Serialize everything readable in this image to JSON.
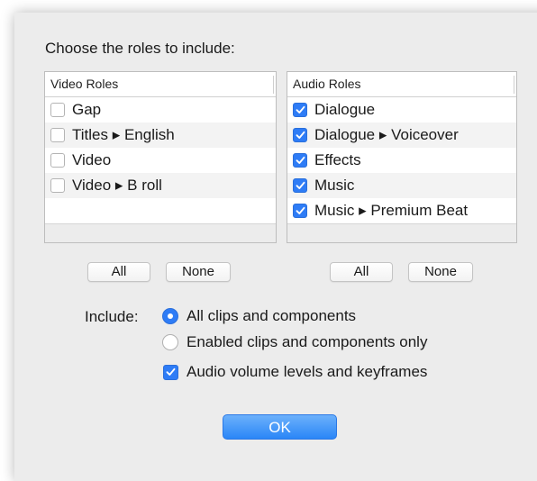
{
  "dialog": {
    "heading": "Choose the roles to include:"
  },
  "video_roles": {
    "header": "Video Roles",
    "items": [
      {
        "label": "Gap",
        "checked": false
      },
      {
        "label": "Titles ▸ English",
        "checked": false
      },
      {
        "label": "Video",
        "checked": false
      },
      {
        "label": "Video ▸ B roll",
        "checked": false
      }
    ],
    "all_label": "All",
    "none_label": "None"
  },
  "audio_roles": {
    "header": "Audio Roles",
    "items": [
      {
        "label": "Dialogue",
        "checked": true
      },
      {
        "label": "Dialogue ▸ Voiceover",
        "checked": true
      },
      {
        "label": "Effects",
        "checked": true
      },
      {
        "label": "Music",
        "checked": true
      },
      {
        "label": "Music ▸ Premium Beat",
        "checked": true
      }
    ],
    "all_label": "All",
    "none_label": "None"
  },
  "include": {
    "label": "Include:",
    "option_all": "All clips and components",
    "option_enabled": "Enabled clips and components only",
    "selected": "all",
    "audio_levels_label": "Audio volume levels and keyframes",
    "audio_levels_checked": true
  },
  "ok_label": "OK",
  "colors": {
    "accent": "#2e7cf6",
    "dialog_bg": "#ececec"
  }
}
